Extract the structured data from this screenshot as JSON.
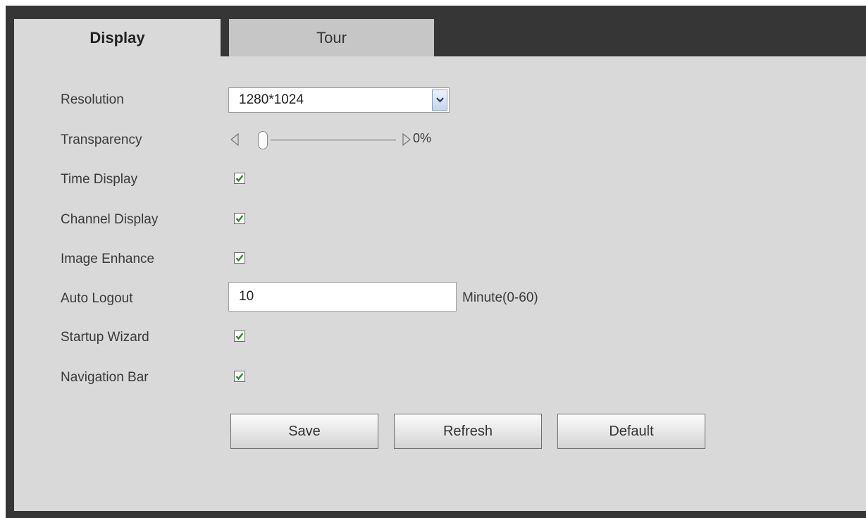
{
  "tabs": [
    {
      "label": "Display",
      "active": true
    },
    {
      "label": "Tour",
      "active": false
    }
  ],
  "settings": {
    "resolution": {
      "label": "Resolution",
      "value": "1280*1024"
    },
    "transparency": {
      "label": "Transparency",
      "value": "0%",
      "level": 0
    },
    "time_display": {
      "label": "Time Display",
      "checked": true
    },
    "channel_display": {
      "label": "Channel Display",
      "checked": true
    },
    "image_enhance": {
      "label": "Image Enhance",
      "checked": true
    },
    "auto_logout": {
      "label": "Auto Logout",
      "value": "10",
      "unit": "Minute(0-60)"
    },
    "startup_wizard": {
      "label": "Startup Wizard",
      "checked": true
    },
    "navigation_bar": {
      "label": "Navigation Bar",
      "checked": true
    }
  },
  "buttons": {
    "save": "Save",
    "refresh": "Refresh",
    "default": "Default"
  },
  "icons": {
    "checkmark": "check-icon",
    "dropdown": "chevron-down-icon",
    "slider_left": "triangle-left-icon",
    "slider_right": "triangle-right-icon"
  },
  "colors": {
    "frame": "#363636",
    "panel": "#d9d9d9",
    "check": "#2e8b2e"
  }
}
